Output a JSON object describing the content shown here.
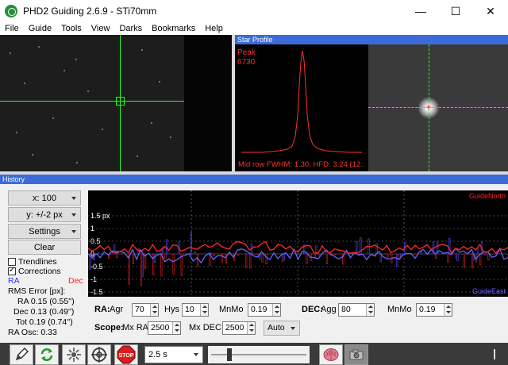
{
  "window": {
    "title": "PHD2 Guiding 2.6.9 - STi70mm",
    "controls": {
      "minimize": "—",
      "maximize": "☐",
      "close": "✕"
    }
  },
  "menu": [
    "File",
    "Guide",
    "Tools",
    "View",
    "Darks",
    "Bookmarks",
    "Help"
  ],
  "star_profile": {
    "title": "Star Profile",
    "peak_label": "Peak",
    "peak_value": "6730",
    "footer": "Mid row FWHM: 1.30, HFD: 3.24 (12.:"
  },
  "history": {
    "title": "History",
    "x_scale": "x: 100",
    "y_scale": "y: +/-2 px",
    "settings": "Settings",
    "clear": "Clear",
    "trendlines": {
      "label": "Trendlines",
      "checked": false
    },
    "corrections": {
      "label": "Corrections",
      "checked": true
    },
    "ra_label": "RA",
    "dec_label": "Dec",
    "rms_title": "RMS Error [px]:",
    "rms_ra": "RA 0.15 (0.55'')",
    "rms_dec": "Dec 0.13 (0.49'')",
    "rms_tot": "Tot 0.19 (0.74'')",
    "ra_osc": "RA Osc: 0.33",
    "y_ticks": [
      "1.5 px",
      "1",
      "0.5",
      "0",
      "-0.5",
      "-1",
      "-1.5"
    ],
    "guide_north": "GuideNorth",
    "guide_east": "GuideEast",
    "colors": {
      "ra": "#3333ff",
      "dec": "#ff2020",
      "ra_line": "#6464ff",
      "dec_line": "#ff2a2a"
    }
  },
  "params": {
    "ra_label": "RA:",
    "agr_label": "Agr",
    "agr_value": "70",
    "hys_label": "Hys",
    "hys_value": "10",
    "mnmo_label": "MnMo",
    "ra_mnmo_value": "0.19",
    "dec_label": "DEC:",
    "agg_label": "Agg",
    "agg_value": "80",
    "dec_mnmo_label": "MnMo",
    "dec_mnmo_value": "0.19",
    "scope_label": "Scope:",
    "mxra_label": "Mx RA",
    "mxra_value": "2500",
    "mxdec_label": "Mx DEC",
    "mxdec_value": "2500",
    "mode_value": "Auto"
  },
  "toolbar": {
    "exposure": "2.5 s",
    "icons": [
      "pencil-icon",
      "loop-icon",
      "auto-star-icon",
      "guide-target-icon",
      "stop-icon",
      "brain-icon",
      "camera-icon"
    ]
  }
}
